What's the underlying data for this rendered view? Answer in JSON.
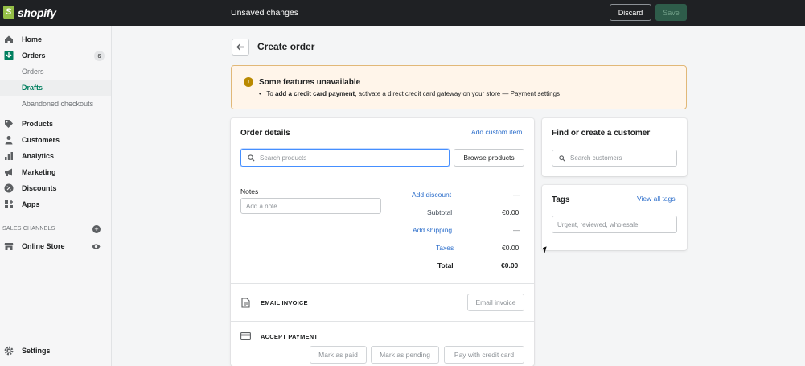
{
  "topbar": {
    "logo_text": "shopify",
    "status": "Unsaved changes",
    "discard_label": "Discard",
    "save_label": "Save"
  },
  "sidebar": {
    "home": "Home",
    "orders": "Orders",
    "orders_badge": "6",
    "orders_sub": "Orders",
    "drafts": "Drafts",
    "abandoned": "Abandoned checkouts",
    "products": "Products",
    "customers": "Customers",
    "analytics": "Analytics",
    "marketing": "Marketing",
    "discounts": "Discounts",
    "apps": "Apps",
    "sales_channels": "SALES CHANNELS",
    "online_store": "Online Store",
    "settings": "Settings"
  },
  "page": {
    "title": "Create order"
  },
  "banner": {
    "title": "Some features unavailable",
    "bullet": "•",
    "text_to": "To",
    "text_bold": "add a credit card payment",
    "text_activate": ", activate a",
    "link_gateway": "direct credit card gateway",
    "text_on_store": "on your store —",
    "link_payment_settings": "Payment settings"
  },
  "order_details": {
    "title": "Order details",
    "add_custom_item": "Add custom item",
    "search_placeholder": "Search products",
    "browse_label": "Browse products",
    "notes_label": "Notes",
    "notes_placeholder": "Add a note...",
    "add_discount": "Add discount",
    "discount_value": "—",
    "subtotal_label": "Subtotal",
    "subtotal_value": "€0.00",
    "add_shipping": "Add shipping",
    "shipping_value": "—",
    "taxes_label": "Taxes",
    "taxes_value": "€0.00",
    "total_label": "Total",
    "total_value": "€0.00"
  },
  "email_invoice": {
    "heading": "EMAIL INVOICE",
    "button": "Email invoice"
  },
  "accept_payment": {
    "heading": "ACCEPT PAYMENT",
    "mark_paid": "Mark as paid",
    "mark_pending": "Mark as pending",
    "pay_card": "Pay with credit card"
  },
  "customer": {
    "title": "Find or create a customer",
    "search_placeholder": "Search customers"
  },
  "tags": {
    "title": "Tags",
    "view_all": "View all tags",
    "placeholder": "Urgent, reviewed, wholesale"
  },
  "colors": {
    "topbar": "#1f2124",
    "accent_green": "#007f5f",
    "link_blue": "#2c6ecb",
    "banner_bg": "#fff5ea",
    "banner_border": "#e1b878"
  }
}
